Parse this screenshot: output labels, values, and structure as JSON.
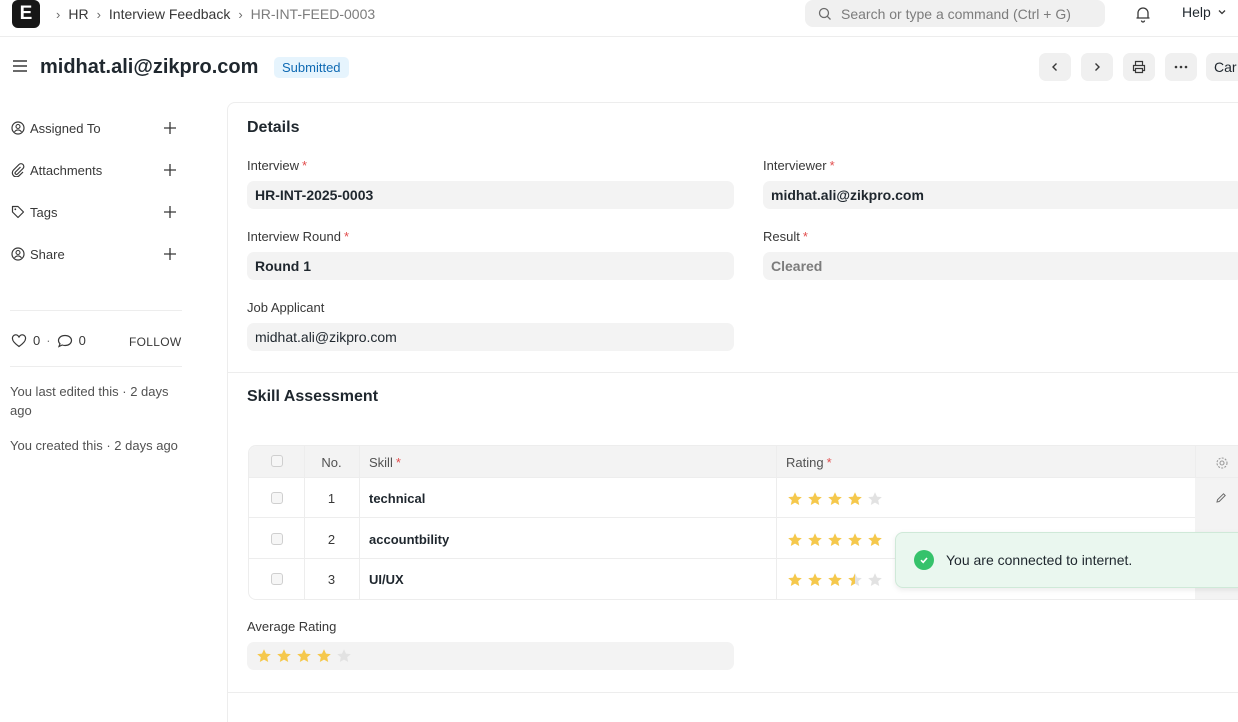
{
  "nav": {
    "logo_letter": "E",
    "breadcrumbs": [
      "HR",
      "Interview Feedback",
      "HR-INT-FEED-0003"
    ],
    "search_placeholder": "Search or type a command (Ctrl + G)",
    "help_label": "Help"
  },
  "header": {
    "title": "midhat.ali@zikpro.com",
    "status": "Submitted",
    "cancel_label": "Car"
  },
  "sidebar": {
    "items": [
      {
        "label": "Assigned To",
        "icon": "assign-icon"
      },
      {
        "label": "Attachments",
        "icon": "paperclip-icon"
      },
      {
        "label": "Tags",
        "icon": "tag-icon"
      },
      {
        "label": "Share",
        "icon": "share-icon"
      }
    ],
    "likes": "0",
    "comments": "0",
    "follow_label": "FOLLOW",
    "last_edited": "You last edited this · 2 days ago",
    "created": "You created this · 2 days ago"
  },
  "details": {
    "section_title": "Details",
    "interview_label": "Interview",
    "interview_value": "HR-INT-2025-0003",
    "interviewer_label": "Interviewer",
    "interviewer_value": "midhat.ali@zikpro.com",
    "round_label": "Interview Round",
    "round_value": "Round 1",
    "result_label": "Result",
    "result_value": "Cleared",
    "applicant_label": "Job Applicant",
    "applicant_value": "midhat.ali@zikpro.com"
  },
  "skills": {
    "section_title": "Skill Assessment",
    "col_no": "No.",
    "col_skill": "Skill",
    "col_rating": "Rating",
    "rows": [
      {
        "no": "1",
        "skill": "technical",
        "rating": 4
      },
      {
        "no": "2",
        "skill": "accountbility",
        "rating": 5
      },
      {
        "no": "3",
        "skill": "UI/UX",
        "rating": 3.5
      }
    ],
    "avg_label": "Average Rating",
    "avg_rating": 4
  },
  "toast": {
    "message": "You are connected to internet."
  },
  "colors": {
    "star_on": "#f5c84c",
    "star_off": "#e2e2e2",
    "badge_bg": "#e6f4fd",
    "badge_text": "#0f6ab3",
    "toast_bg": "#eaf7ef"
  }
}
